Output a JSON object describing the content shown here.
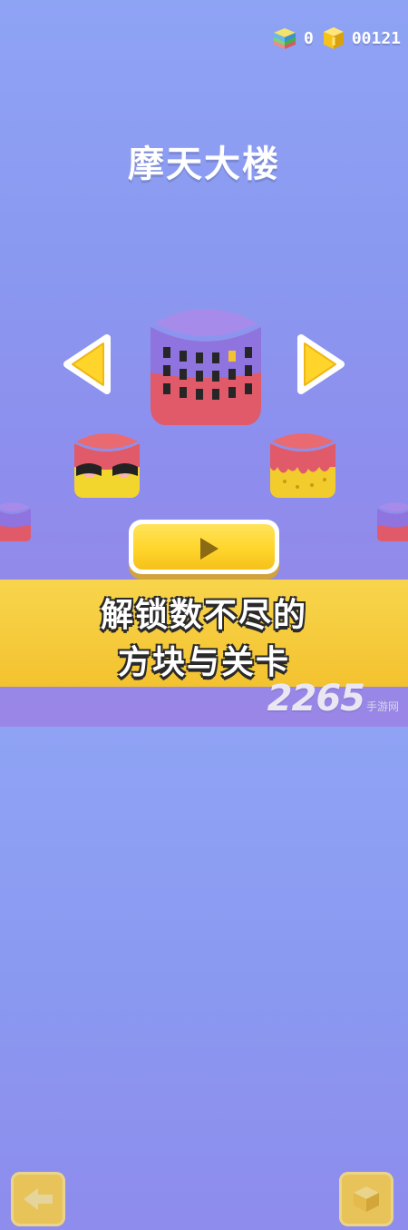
{
  "counters": {
    "bricks_value": "0",
    "coins_value": "00121",
    "bricks_icon": "brick-stack-icon",
    "coins_icon": "coin-icon"
  },
  "title": "摩天大楼",
  "banner": {
    "line1": "解锁数不尽的",
    "line2": "方块与关卡"
  },
  "watermark": {
    "number": "2265",
    "site": "手游网"
  },
  "icons": {
    "prev": "arrow-left-icon",
    "next": "arrow-right-icon",
    "play": "play-icon"
  },
  "colors": {
    "accent_yellow": "#ffd52b",
    "cube_top_purple": "#9d7ee6",
    "cube_body_red": "#e05a6a"
  }
}
